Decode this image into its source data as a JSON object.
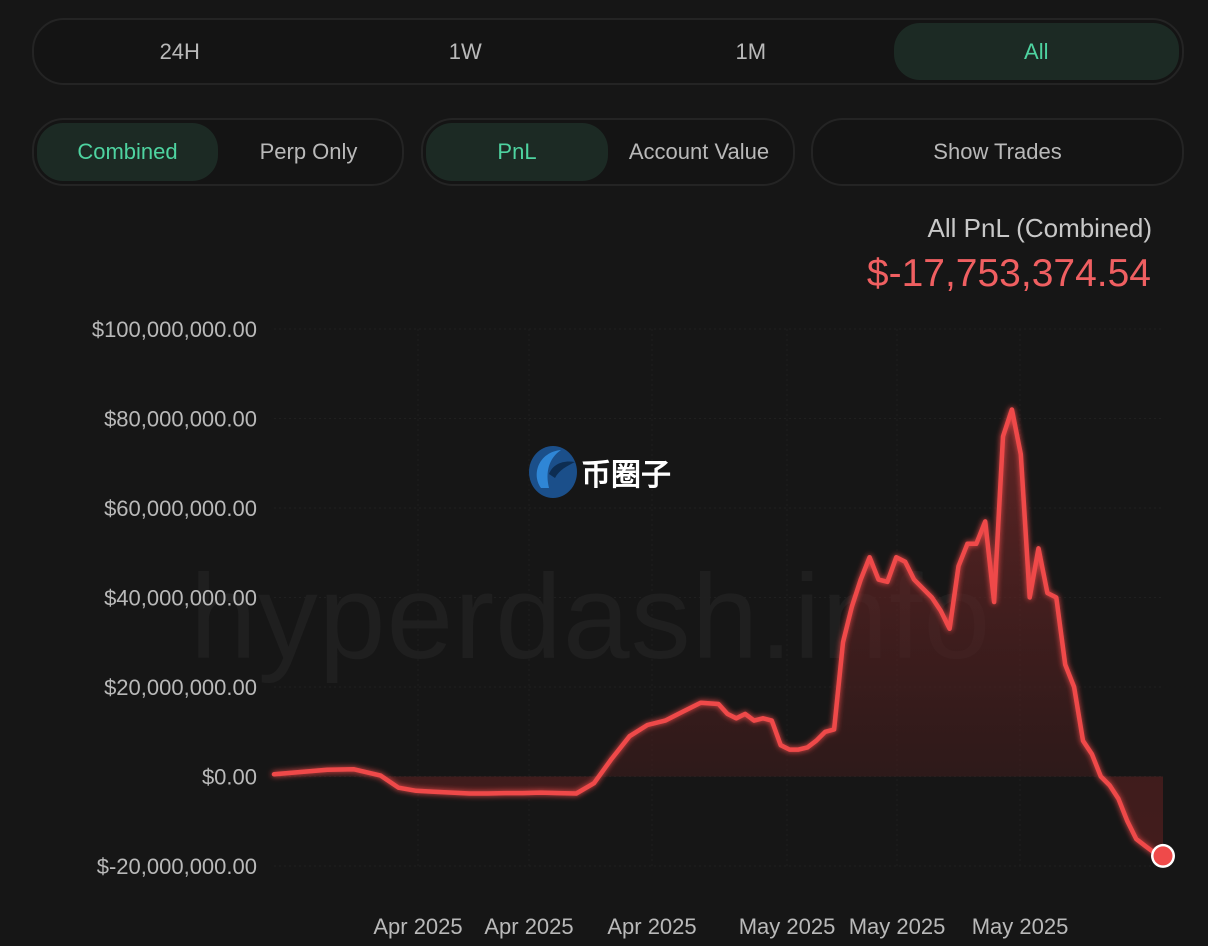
{
  "range_tabs": [
    {
      "label": "24H",
      "active": false
    },
    {
      "label": "1W",
      "active": false
    },
    {
      "label": "1M",
      "active": false
    },
    {
      "label": "All",
      "active": true
    }
  ],
  "mode_tabs": [
    {
      "label": "Combined",
      "active": true
    },
    {
      "label": "Perp Only",
      "active": false
    }
  ],
  "metric_tabs": [
    {
      "label": "PnL",
      "active": true
    },
    {
      "label": "Account Value",
      "active": false
    }
  ],
  "show_trades_label": "Show Trades",
  "pnl": {
    "title": "All PnL (Combined)",
    "value": "$-17,753,374.54"
  },
  "watermark": "hyperdash.info",
  "logo": {
    "text": "币圈子"
  },
  "colors": {
    "accent": "#4ed3a0",
    "line": "#ef4a4a",
    "negative_text": "#ef5f61",
    "background": "#161616"
  },
  "chart_data": {
    "type": "area",
    "series": [
      {
        "x": [
          0,
          3,
          6,
          9,
          12,
          14,
          16,
          18,
          20,
          22,
          24,
          26,
          28,
          30,
          32,
          34,
          36,
          38,
          40,
          42,
          44,
          46,
          48,
          50,
          51,
          52,
          53,
          54,
          55,
          56,
          57,
          58,
          59,
          60,
          61,
          62,
          63,
          64,
          65,
          66,
          67,
          68,
          69,
          70,
          71,
          72,
          73,
          74,
          75,
          76,
          77,
          78,
          79,
          80,
          81,
          82,
          83,
          84,
          85,
          86,
          87,
          88,
          89,
          90,
          91,
          92,
          93,
          94,
          95,
          96,
          97,
          98,
          99,
          100
        ],
        "values": [
          0.5,
          1.0,
          1.5,
          1.6,
          0.2,
          -2.5,
          -3.2,
          -3.4,
          -3.6,
          -3.8,
          -3.8,
          -3.7,
          -3.7,
          -3.6,
          -3.7,
          -3.8,
          -1.5,
          4,
          9,
          11.5,
          12.5,
          14.5,
          16.5,
          16.2,
          14,
          13,
          14,
          12.5,
          13,
          12.5,
          7,
          6,
          6,
          6.5,
          8,
          10,
          10.5,
          30,
          38,
          44,
          49,
          44,
          43.5,
          49,
          48,
          44,
          42,
          40,
          37,
          33,
          47,
          52,
          52,
          57,
          39,
          76,
          82,
          72,
          40,
          51,
          41,
          40,
          25,
          20,
          8,
          5,
          0,
          -2,
          -5,
          -10,
          -14,
          -15.5,
          -17,
          -17.75
        ]
      }
    ],
    "x_tick_labels": [
      "Apr 2025",
      "Apr 2025",
      "Apr 2025",
      "May 2025",
      "May 2025",
      "May 2025"
    ],
    "y_tick_labels": [
      "$100,000,000.00",
      "$80,000,000.00",
      "$60,000,000.00",
      "$40,000,000.00",
      "$20,000,000.00",
      "$0.00",
      "$-20,000,000.00"
    ],
    "ylim": [
      -20,
      100
    ],
    "y_unit": "millions USD",
    "grid": true,
    "legend": "none"
  }
}
